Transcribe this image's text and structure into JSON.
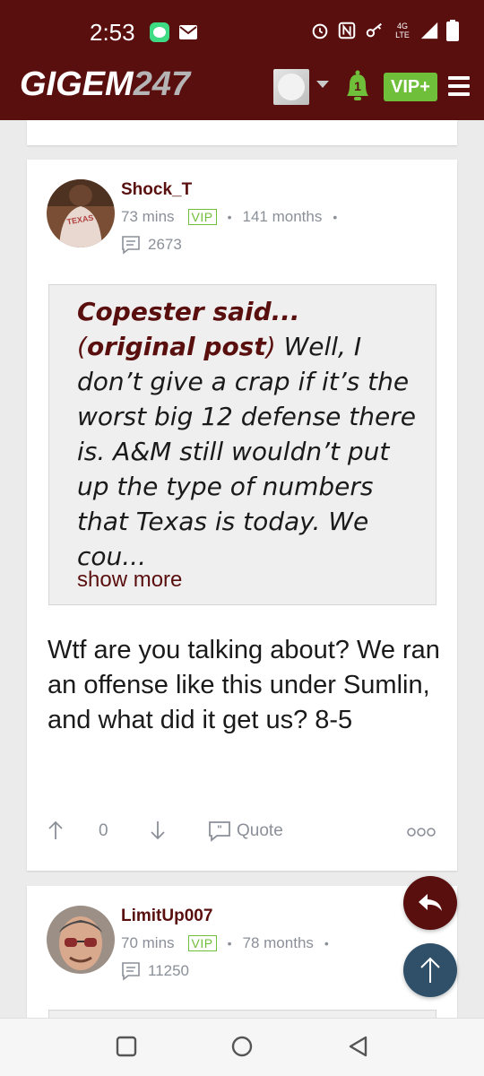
{
  "status_bar": {
    "time": "2:53",
    "network": "4G LTE",
    "icons": [
      "message-app-icon",
      "mail-icon",
      "alarm-icon",
      "nfc-icon",
      "key-icon",
      "signal-icon",
      "battery-icon"
    ]
  },
  "header": {
    "logo_text": "GIGEM",
    "logo_number": "247",
    "notification_count": "1",
    "vip_label": "VIP+"
  },
  "posts": [
    {
      "username": "Shock_T",
      "time_ago": "73 mins",
      "badge": "VIP",
      "tenure": "141 months",
      "post_count": "2673",
      "quote": {
        "author": "Copester said...",
        "link_text": "original post",
        "text": "Well, I don’t give a crap if it’s the worst big 12 defense there is. A&M still wouldn’t put up the type of numbers that Texas is today. We cou...",
        "show_more": "show more"
      },
      "body": "Wtf are you talking about? We ran an offense like this under Sumlin, and what did it get us? 8-5",
      "votes": "0",
      "quote_label": "Quote"
    },
    {
      "username": "LimitUp007",
      "time_ago": "70 mins",
      "badge": "VIP",
      "tenure": "78 months",
      "post_count": "11250"
    }
  ],
  "separator": "•",
  "colors": {
    "brand_maroon": "#5a0f0f",
    "vip_green": "#6fbf3a",
    "scroll_top_blue": "#2f5068",
    "meta_gray": "#8a8f98"
  }
}
